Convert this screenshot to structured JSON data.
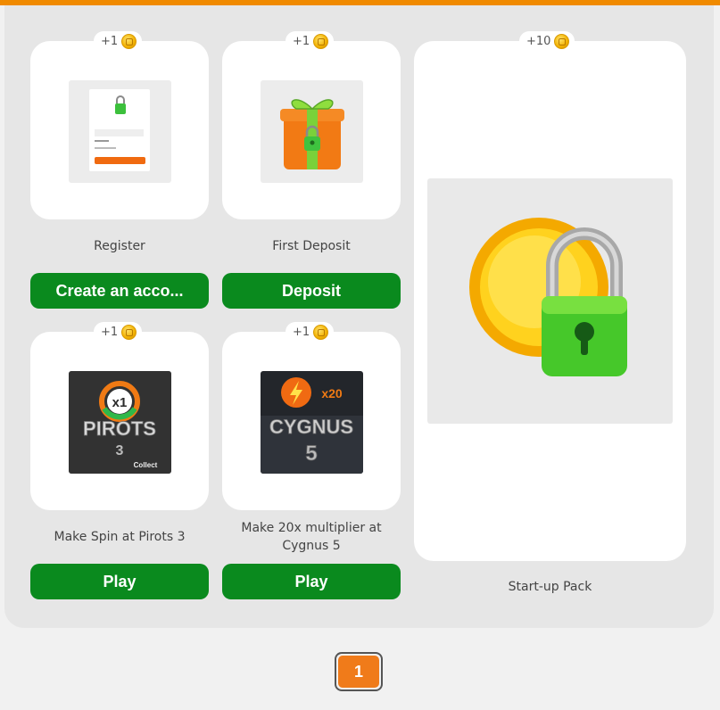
{
  "cards": [
    {
      "reward": "+1",
      "title": "Register",
      "button": "Create an acco...",
      "thumb": "register-form-lock"
    },
    {
      "reward": "+1",
      "title": "First Deposit",
      "button": "Deposit",
      "thumb": "gift-box-lock"
    },
    {
      "reward": "+10",
      "title": "Start-up Pack",
      "thumb": "coin-lock"
    },
    {
      "reward": "+1",
      "title": "Make Spin at Pirots 3",
      "button": "Play",
      "thumb": "pirots-3-game",
      "thumb_badge": "x1",
      "thumb_text": "PIROTS",
      "thumb_subtext": "Collect"
    },
    {
      "reward": "+1",
      "title": "Make 20x multiplier at Cygnus 5",
      "button": "Play",
      "thumb": "cygnus-5-game",
      "thumb_badge": "x20",
      "thumb_text": "CYGNUS"
    }
  ],
  "pagination": {
    "current": "1"
  },
  "colors": {
    "accent": "#f08a00",
    "button": "#0a8a1e",
    "page_active": "#f07b1a"
  }
}
